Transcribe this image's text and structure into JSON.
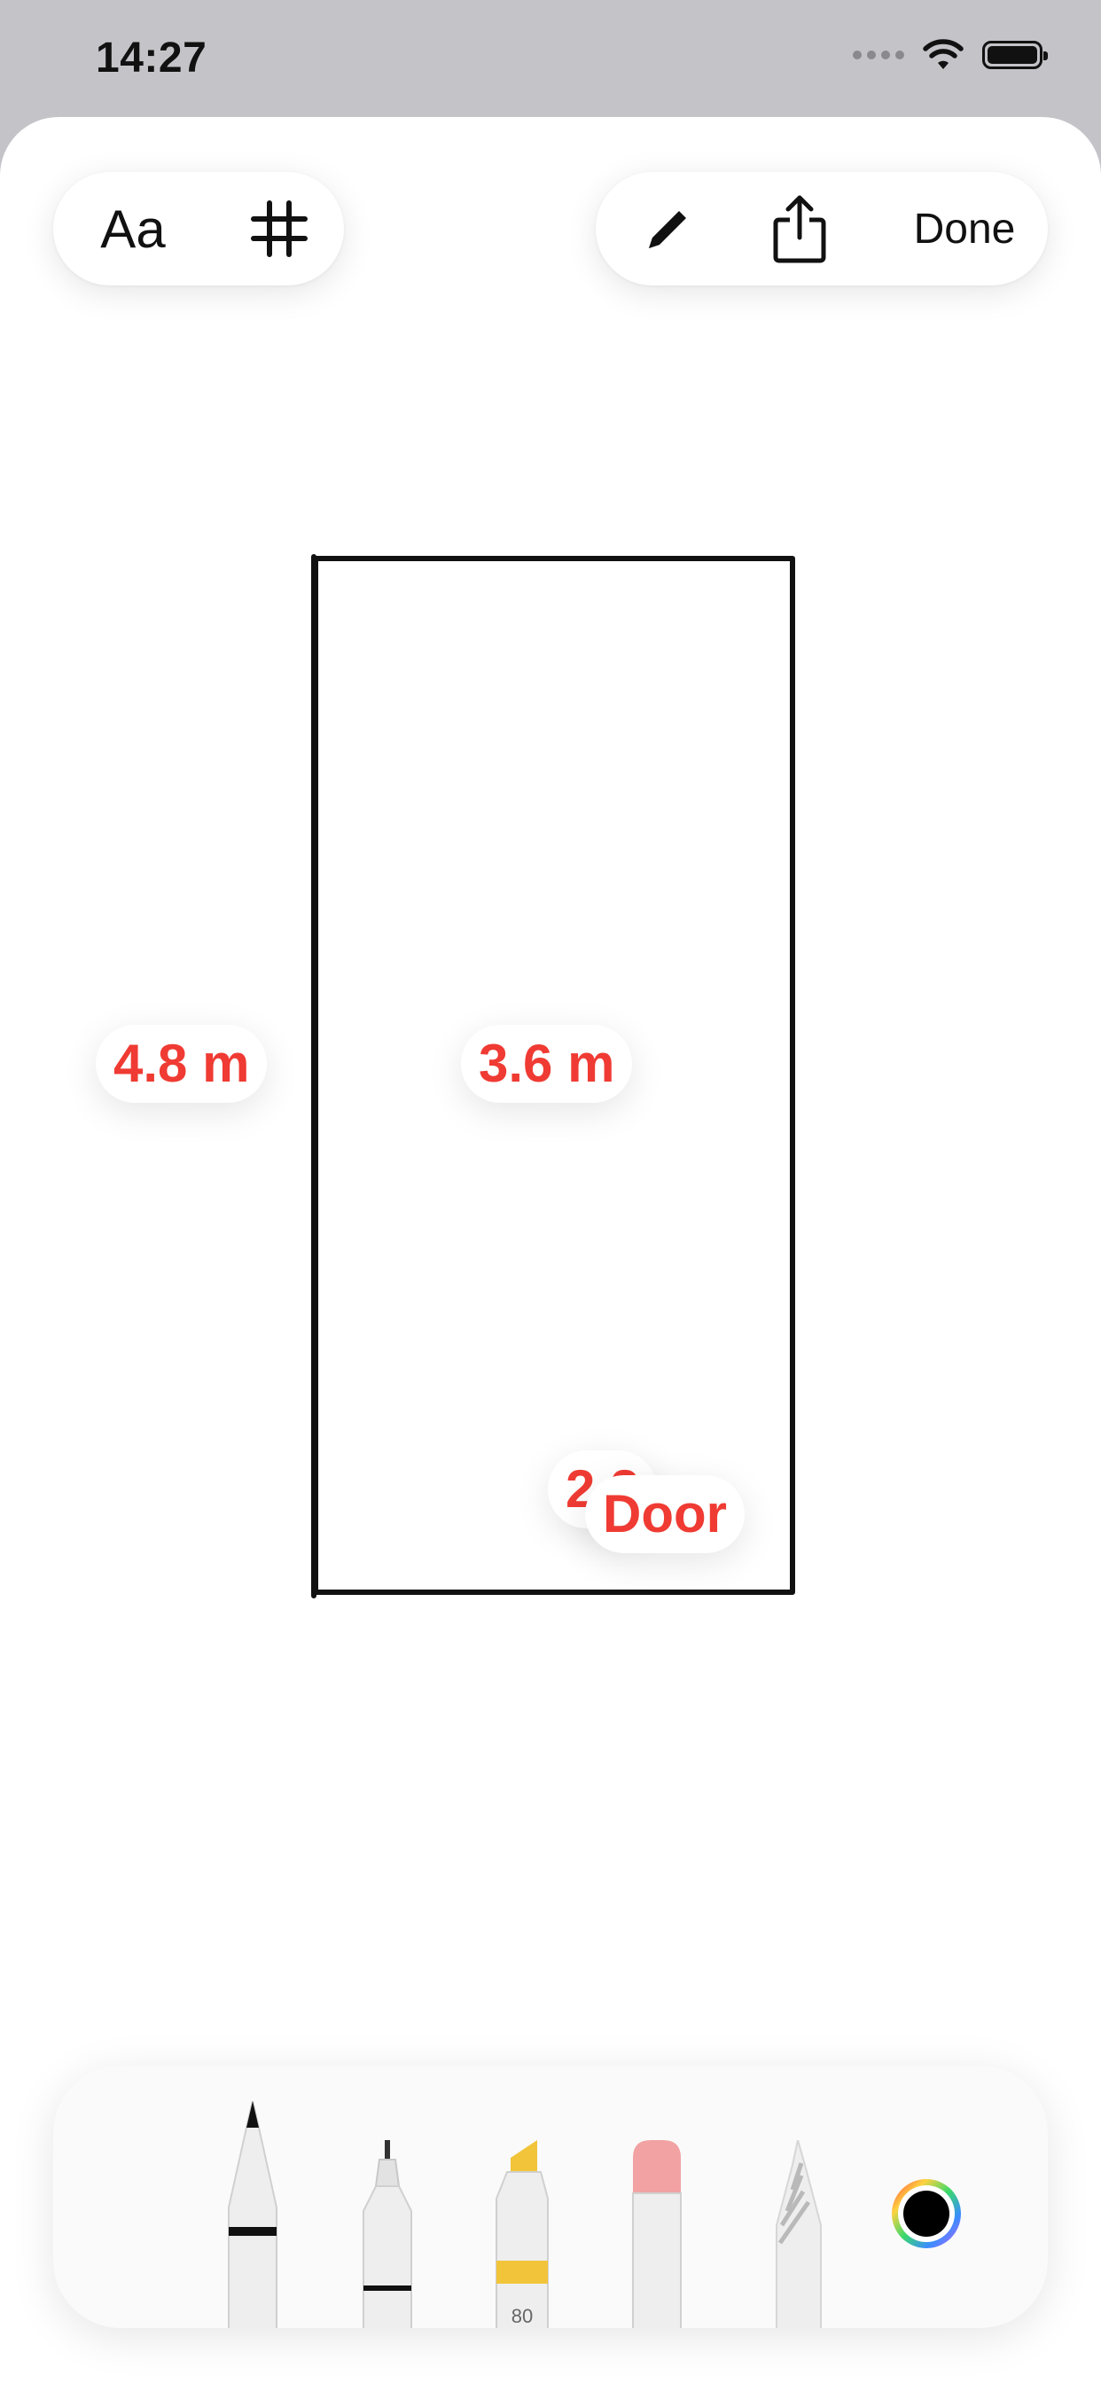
{
  "status_bar": {
    "time": "14:27"
  },
  "toolbar": {
    "text_button_label": "Aa",
    "done_label": "Done"
  },
  "labels": {
    "left_dimension": "4.8 m",
    "center_dimension": "3.6 m",
    "bottom_dimension": "2.2",
    "door": "Door"
  },
  "tools": {
    "marker_opacity_label": "80"
  },
  "colors": {
    "label_text": "#ef3b33",
    "stroke": "#111111",
    "marker_yellow": "#f2c43a",
    "eraser_pink": "#f2a2a2",
    "active_color": "#000000"
  },
  "icons": {
    "grid": "hash-grid-icon",
    "pencil": "pencil-icon",
    "share": "share-icon",
    "wifi": "wifi-icon",
    "battery": "battery-icon"
  }
}
